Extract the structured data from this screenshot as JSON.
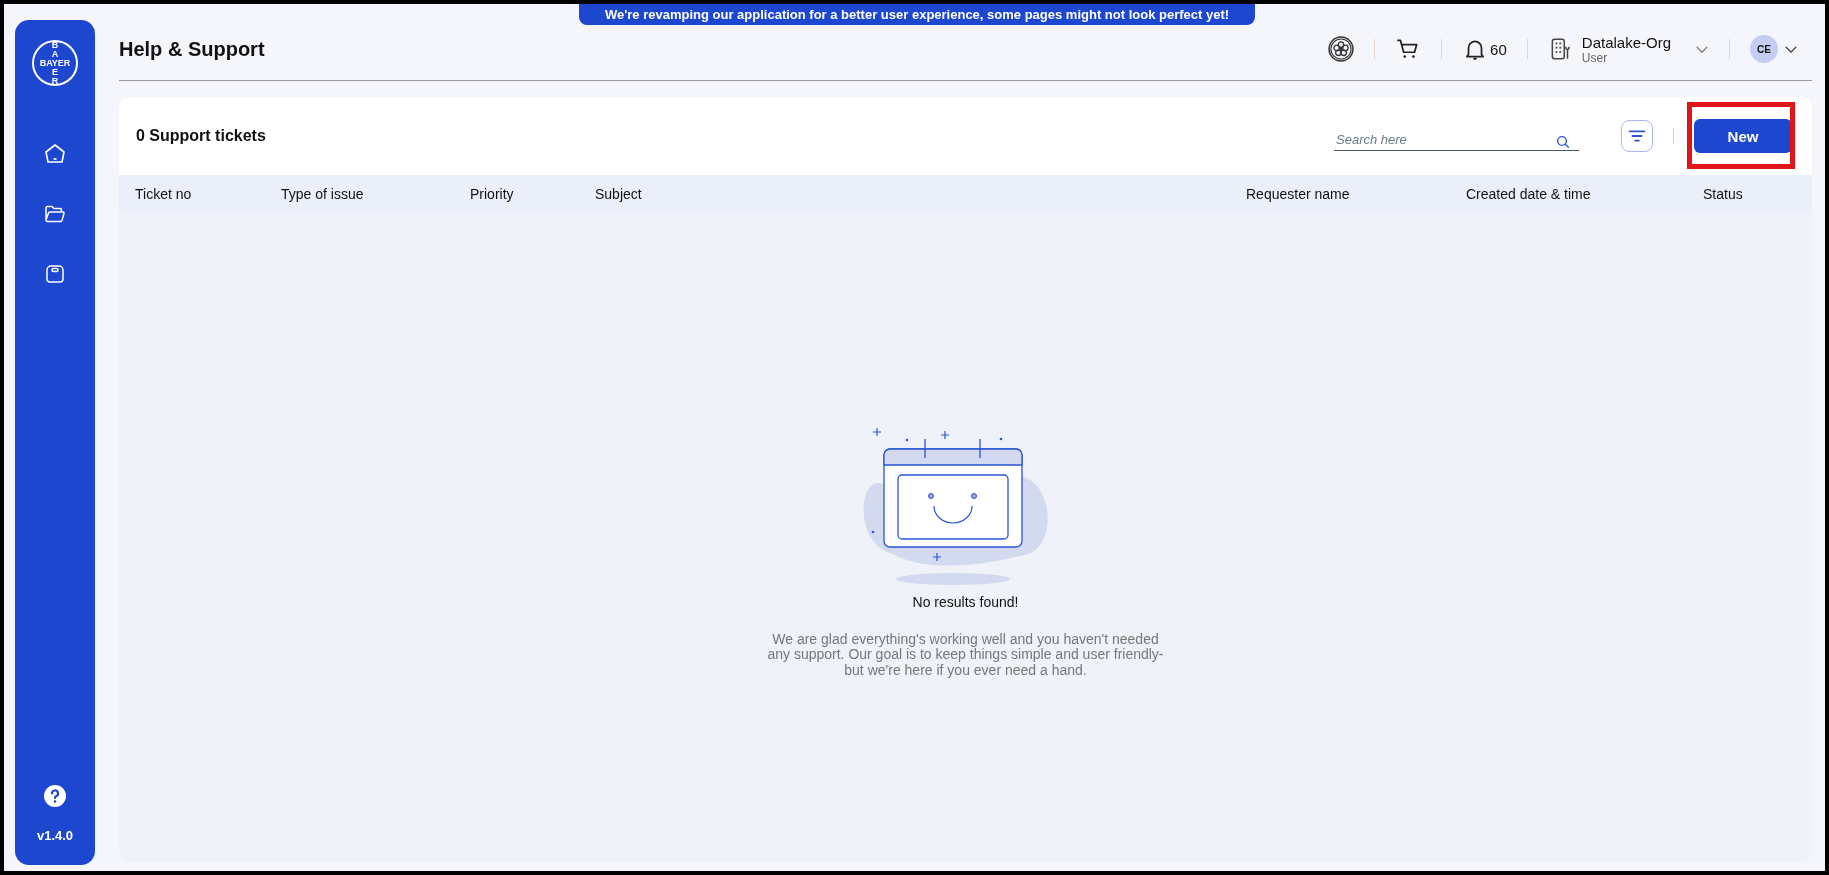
{
  "banner": {
    "text": "We're revamping our application for a better user experience, some pages might not look perfect yet!"
  },
  "sidebar": {
    "logo": {
      "text": "BAYER",
      "vertical_letters": [
        "B",
        "A",
        "E",
        "R"
      ]
    },
    "version": "v1.4.0"
  },
  "header": {
    "title": "Help & Support",
    "notifications": {
      "count": "60"
    },
    "org": {
      "name": "Datalake-Org",
      "role": "User"
    },
    "avatar": {
      "initials": "CE"
    }
  },
  "tickets": {
    "title": "0 Support tickets",
    "search": {
      "placeholder": "Search here"
    },
    "new_button": "New",
    "columns": [
      "Ticket no",
      "Type of issue",
      "Priority",
      "Subject",
      "Requester name",
      "Created date & time",
      "Status"
    ],
    "empty": {
      "title": "No results found!",
      "message": "We are glad everything's working well and you haven't needed any support. Our goal is to keep things simple and user friendly- but we're here if you ever need a hand."
    }
  }
}
